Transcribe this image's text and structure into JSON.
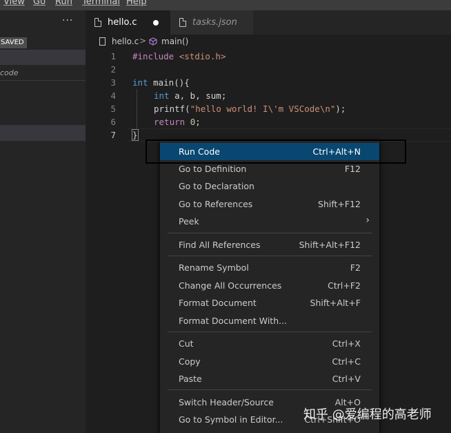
{
  "menubar": {
    "items": [
      "View",
      "Go",
      "Run",
      "Terminal",
      "Help"
    ]
  },
  "sidebar": {
    "more": "···",
    "saved_badge": "SAVED",
    "folder_text": "code"
  },
  "tabs": [
    {
      "label": "hello.c",
      "active": true,
      "dirty": true
    },
    {
      "label": "tasks.json",
      "active": false
    }
  ],
  "breadcrumb": {
    "file": "hello.c",
    "separator": ">",
    "symbol": "main()"
  },
  "editor": {
    "line_numbers": [
      "1",
      "2",
      "3",
      "4",
      "5",
      "6",
      "7"
    ],
    "lines": {
      "l1_directive": "#include",
      "l1_header": " <stdio.h>",
      "l3_type": "int",
      "l3_rest": " main(){",
      "l4_type": "int",
      "l4_rest": " a, b, sum;",
      "l5_fn": "printf(",
      "l5_str": "\"hello world! I\\'m VSCode\\n\"",
      "l5_end": ");",
      "l6_kw": "return",
      "l6_sp": " ",
      "l6_num": "0",
      "l6_end": ";",
      "l7_brace": "}"
    }
  },
  "context_menu": {
    "groups": [
      [
        {
          "label": "Run Code",
          "shortcut": "Ctrl+Alt+N"
        },
        {
          "label": "Go to Definition",
          "shortcut": "F12"
        },
        {
          "label": "Go to Declaration",
          "shortcut": ""
        },
        {
          "label": "Go to References",
          "shortcut": "Shift+F12"
        },
        {
          "label": "Peek",
          "shortcut": ""
        }
      ],
      [
        {
          "label": "Find All References",
          "shortcut": "Shift+Alt+F12"
        }
      ],
      [
        {
          "label": "Rename Symbol",
          "shortcut": "F2"
        },
        {
          "label": "Change All Occurrences",
          "shortcut": "Ctrl+F2"
        },
        {
          "label": "Format Document",
          "shortcut": "Shift+Alt+F"
        },
        {
          "label": "Format Document With...",
          "shortcut": ""
        }
      ],
      [
        {
          "label": "Cut",
          "shortcut": "Ctrl+X"
        },
        {
          "label": "Copy",
          "shortcut": "Ctrl+C"
        },
        {
          "label": "Paste",
          "shortcut": "Ctrl+V"
        }
      ],
      [
        {
          "label": "Switch Header/Source",
          "shortcut": "Alt+O"
        },
        {
          "label": "Go to Symbol in Editor...",
          "shortcut": "Ctrl+Shift+O"
        }
      ]
    ]
  },
  "watermark": "知乎 @爱编程的高老师",
  "colors": {
    "highlight": "#094771",
    "keyword": "#569cd6",
    "control": "#c586c0",
    "string": "#ce9178",
    "number": "#b5cea8",
    "symbol_icon": "#b180d7"
  }
}
